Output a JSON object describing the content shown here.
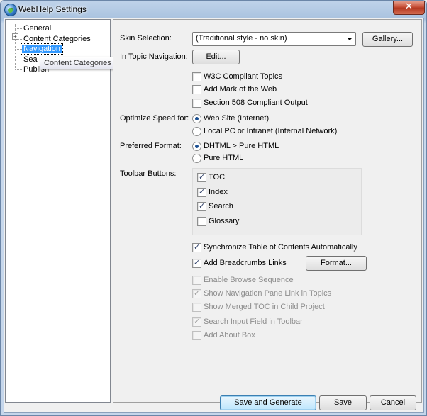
{
  "window": {
    "title": "WebHelp Settings",
    "close_glyph": "✕"
  },
  "tree": {
    "items": [
      {
        "label": "General"
      },
      {
        "label": "Content Categories",
        "expander": "+"
      },
      {
        "label": "Navigation",
        "selected": true
      },
      {
        "label": "Sea"
      },
      {
        "label": "Publish"
      }
    ],
    "tooltip": "Content Categories"
  },
  "skin": {
    "label": "Skin Selection:",
    "value": "(Traditional style - no skin)",
    "gallery_label": "Gallery..."
  },
  "in_topic": {
    "label": "In Topic Navigation:",
    "edit_label": "Edit..."
  },
  "topic_options": [
    {
      "label": "W3C Compliant Topics",
      "checked": false
    },
    {
      "label": "Add Mark of the Web",
      "checked": false
    },
    {
      "label": "Section 508 Compliant Output",
      "checked": false
    }
  ],
  "optimize": {
    "label": "Optimize Speed for:",
    "options": [
      {
        "label": "Web Site (Internet)",
        "selected": true
      },
      {
        "label": "Local PC or Intranet (Internal Network)",
        "selected": false
      }
    ]
  },
  "format": {
    "label": "Preferred Format:",
    "options": [
      {
        "label": "DHTML > Pure HTML",
        "selected": true
      },
      {
        "label": "Pure HTML",
        "selected": false
      }
    ]
  },
  "toolbar": {
    "label": "Toolbar Buttons:",
    "items": [
      {
        "label": "TOC",
        "checked": true
      },
      {
        "label": "Index",
        "checked": true
      },
      {
        "label": "Search",
        "checked": true
      },
      {
        "label": "Glossary",
        "checked": false
      }
    ]
  },
  "sync_toc": {
    "label": "Synchronize Table of Contents Automatically",
    "checked": true
  },
  "breadcrumbs": {
    "label": "Add Breadcrumbs Links",
    "checked": true,
    "format_label": "Format..."
  },
  "disabled_options": [
    {
      "label": "Enable Browse Sequence",
      "checked": false
    },
    {
      "label": "Show Navigation Pane Link in Topics",
      "checked": true
    },
    {
      "label": "Show Merged TOC in Child Project",
      "checked": false
    },
    {
      "label": "Search Input Field in Toolbar",
      "checked": true
    },
    {
      "label": "Add About Box",
      "checked": false
    }
  ],
  "footer": {
    "save_generate_label": "Save and Generate",
    "save_label": "Save",
    "cancel_label": "Cancel"
  }
}
